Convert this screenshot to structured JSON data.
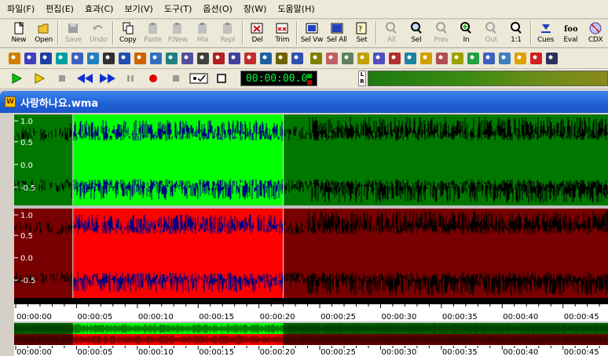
{
  "menu": [
    {
      "label": "파일(F)"
    },
    {
      "label": "편집(E)"
    },
    {
      "label": "효과(C)"
    },
    {
      "label": "보기(V)"
    },
    {
      "label": "도구(T)"
    },
    {
      "label": "옵션(O)"
    },
    {
      "label": "창(W)"
    },
    {
      "label": "도움말(H)"
    }
  ],
  "toolbar": {
    "buttons": [
      {
        "label": "New",
        "icon": "new-file-icon",
        "enabled": true
      },
      {
        "label": "Open",
        "icon": "open-folder-icon",
        "enabled": true
      },
      {
        "label": "Save",
        "icon": "save-disk-icon",
        "enabled": false
      },
      {
        "label": "Undo",
        "icon": "undo-icon",
        "enabled": false
      },
      {
        "label": "Copy",
        "icon": "copy-icon",
        "enabled": true
      },
      {
        "label": "Paste",
        "icon": "paste-icon",
        "enabled": false
      },
      {
        "label": "P.New",
        "icon": "paste-new-icon",
        "enabled": false
      },
      {
        "label": "Mix",
        "icon": "mix-icon",
        "enabled": false
      },
      {
        "label": "Repl",
        "icon": "replace-icon",
        "enabled": false
      },
      {
        "label": "Del",
        "icon": "delete-icon",
        "enabled": true
      },
      {
        "label": "Trim",
        "icon": "trim-icon",
        "enabled": true
      },
      {
        "label": "Sel Vw",
        "icon": "select-view-icon",
        "enabled": true
      },
      {
        "label": "Sel All",
        "icon": "select-all-icon",
        "enabled": true
      },
      {
        "label": "Set",
        "icon": "set-icon",
        "enabled": true
      },
      {
        "label": "All",
        "icon": "zoom-all-icon",
        "enabled": false
      },
      {
        "label": "Sel",
        "icon": "zoom-selection-icon",
        "enabled": true
      },
      {
        "label": "Prev",
        "icon": "zoom-previous-icon",
        "enabled": false
      },
      {
        "label": "In",
        "icon": "zoom-in-icon",
        "enabled": true
      },
      {
        "label": "Out",
        "icon": "zoom-out-icon",
        "enabled": false
      },
      {
        "label": "1:1",
        "icon": "zoom-1to1-icon",
        "enabled": true
      },
      {
        "label": "Cues",
        "icon": "cues-icon",
        "enabled": true
      },
      {
        "label": "Eval",
        "icon": "eval-icon",
        "enabled": true
      },
      {
        "label": "CDX",
        "icon": "cdx-icon",
        "enabled": true
      }
    ]
  },
  "effects_toolbar_icons": [
    "effect-1-icon",
    "effect-2-icon",
    "effect-3-icon",
    "effect-4-icon",
    "effect-5-icon",
    "effect-6-icon",
    "effect-7-icon",
    "effect-8-icon",
    "effect-9-icon",
    "effect-10-icon",
    "effect-11-icon",
    "effect-12-icon",
    "effect-13-icon",
    "effect-14-icon",
    "effect-15-icon",
    "effect-16-icon",
    "effect-17-icon",
    "effect-18-icon",
    "effect-19-icon",
    "effect-20-icon",
    "effect-21-icon",
    "effect-22-icon",
    "effect-23-icon",
    "effect-24-icon",
    "effect-25-icon",
    "effect-26-icon",
    "effect-27-icon",
    "effect-28-icon",
    "effect-29-icon",
    "effect-30-icon",
    "effect-31-icon",
    "effect-32-icon",
    "effect-33-icon",
    "effect-34-icon",
    "effect-35-icon"
  ],
  "transport": {
    "time": "00:00:00.0",
    "lr_label": "L R"
  },
  "document": {
    "title": "사랑하나요.wma"
  },
  "channels": [
    {
      "name": "left",
      "axis_labels": [
        "1.0",
        "0.5",
        "0.0",
        "-0.5"
      ],
      "color_normal": "#00ff00",
      "color_dim": "#007800"
    },
    {
      "name": "right",
      "axis_labels": [
        "1.0",
        "0.5",
        "0.0",
        "-0.5"
      ],
      "color_normal": "#ff0000",
      "color_dim": "#780000"
    }
  ],
  "selection": {
    "start_sec": 4.7,
    "end_sec": 22.0
  },
  "timeline": {
    "ticks": [
      "00:00:00",
      "00:00:05",
      "00:00:10",
      "00:00:15",
      "00:00:20",
      "00:00:25",
      "00:00:30",
      "00:00:35",
      "00:00:40",
      "00:00:45"
    ],
    "tick_step_sec": 5,
    "view_end_sec": 48.7
  },
  "colors": {
    "title_bar": "#1f5fd4",
    "timer_text": "#00ff40",
    "wave_underlay": "#000080"
  }
}
